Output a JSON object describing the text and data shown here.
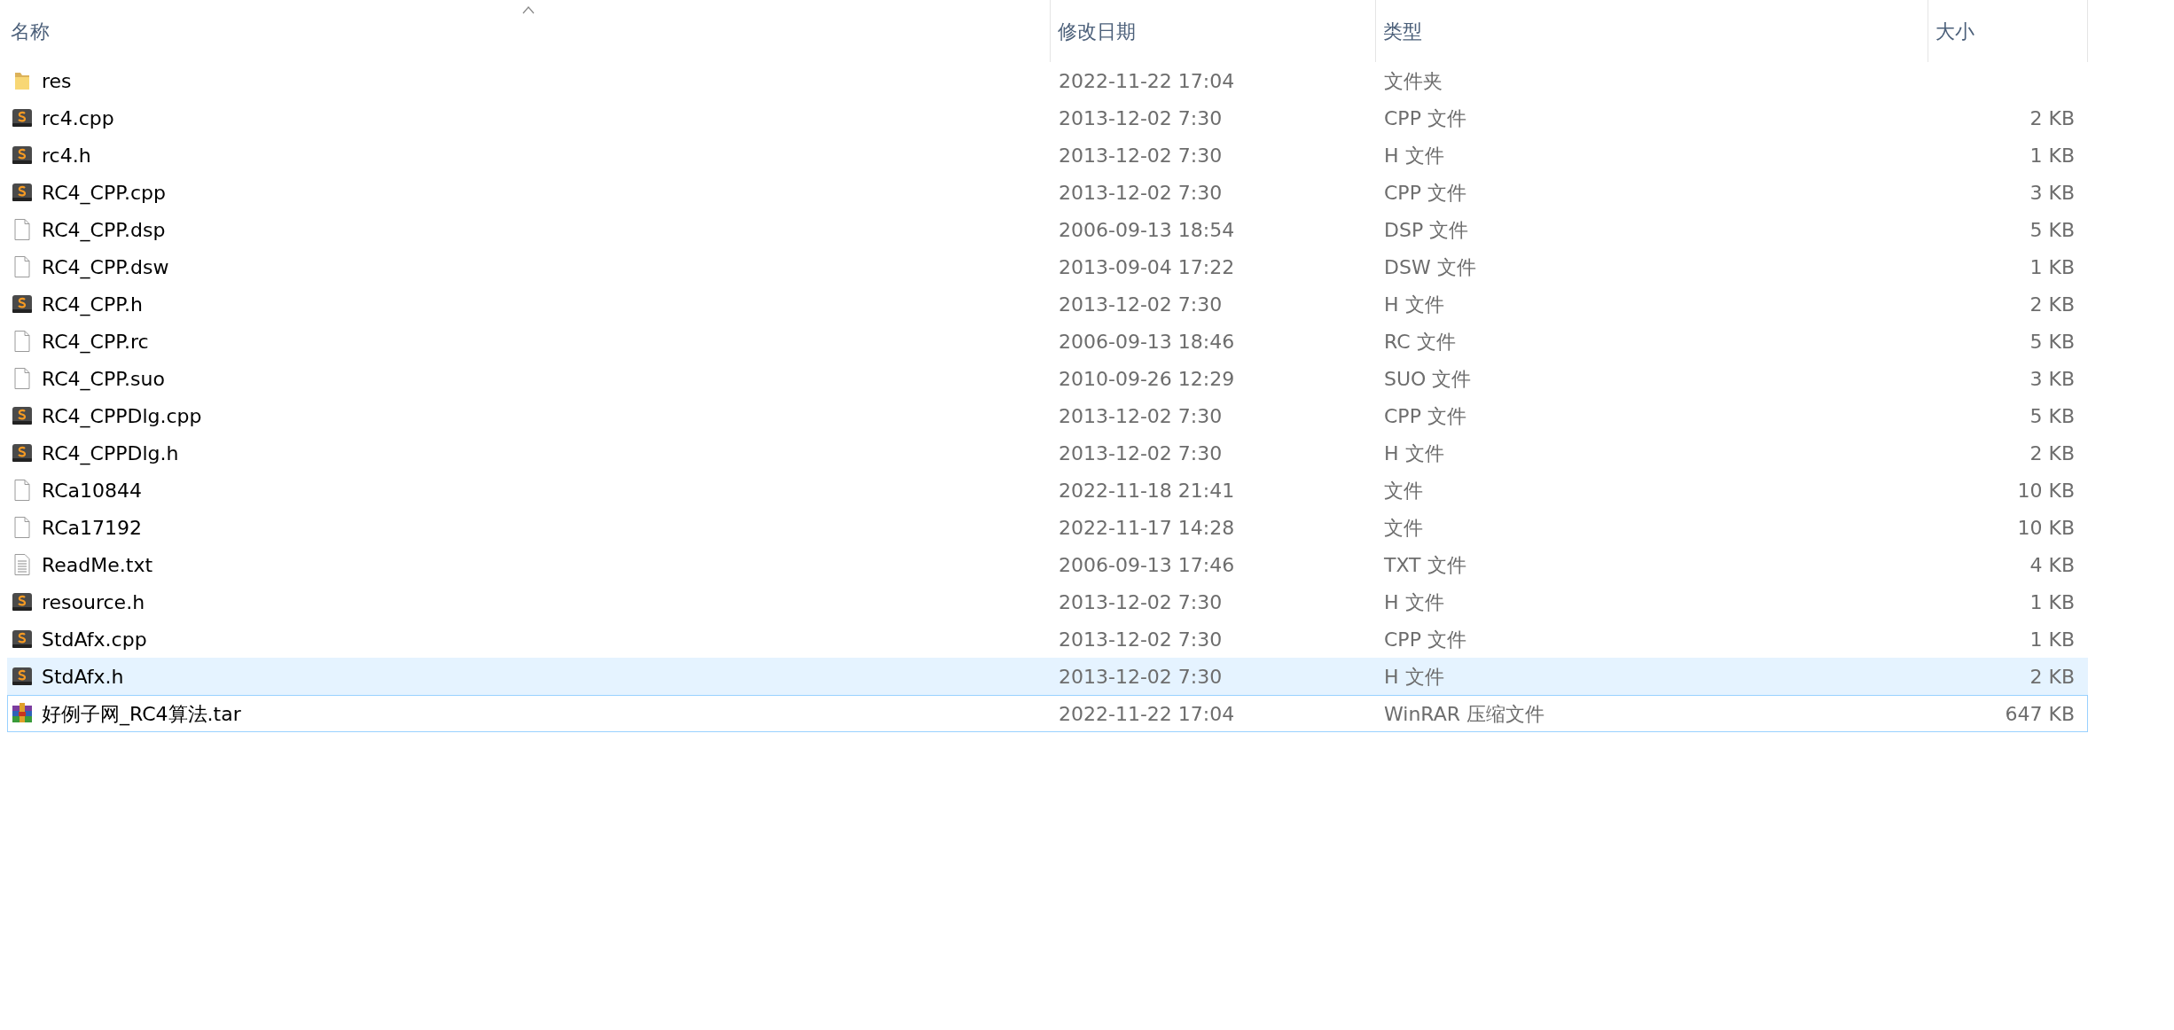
{
  "columns": [
    {
      "label": "名称",
      "sorted": true
    },
    {
      "label": "修改日期",
      "sorted": false
    },
    {
      "label": "类型",
      "sorted": false
    },
    {
      "label": "大小",
      "sorted": false
    }
  ],
  "files": [
    {
      "name": "res",
      "kind": "folder",
      "modified": "2022-11-22 17:04",
      "type": "文件夹",
      "highlighted": false,
      "focused": false
    },
    {
      "name": "rc4.cpp",
      "kind": "source",
      "modified": "2013-12-02 7:30",
      "type": "CPP 文件",
      "size": "2 KB",
      "highlighted": false,
      "focused": false
    },
    {
      "name": "rc4.h",
      "kind": "source",
      "modified": "2013-12-02 7:30",
      "type": "H 文件",
      "size": "1 KB",
      "highlighted": false,
      "focused": false
    },
    {
      "name": "RC4_CPP.cpp",
      "kind": "source",
      "modified": "2013-12-02 7:30",
      "type": "CPP 文件",
      "size": "3 KB",
      "highlighted": false,
      "focused": false
    },
    {
      "name": "RC4_CPP.dsp",
      "kind": "blank",
      "modified": "2006-09-13 18:54",
      "type": "DSP 文件",
      "size": "5 KB",
      "highlighted": false,
      "focused": false
    },
    {
      "name": "RC4_CPP.dsw",
      "kind": "blank",
      "modified": "2013-09-04 17:22",
      "type": "DSW 文件",
      "size": "1 KB",
      "highlighted": false,
      "focused": false
    },
    {
      "name": "RC4_CPP.h",
      "kind": "source",
      "modified": "2013-12-02 7:30",
      "type": "H 文件",
      "size": "2 KB",
      "highlighted": false,
      "focused": false
    },
    {
      "name": "RC4_CPP.rc",
      "kind": "blank",
      "modified": "2006-09-13 18:46",
      "type": "RC 文件",
      "size": "5 KB",
      "highlighted": false,
      "focused": false
    },
    {
      "name": "RC4_CPP.suo",
      "kind": "blank",
      "modified": "2010-09-26 12:29",
      "type": "SUO 文件",
      "size": "3 KB",
      "highlighted": false,
      "focused": false
    },
    {
      "name": "RC4_CPPDlg.cpp",
      "kind": "source",
      "modified": "2013-12-02 7:30",
      "type": "CPP 文件",
      "size": "5 KB",
      "highlighted": false,
      "focused": false
    },
    {
      "name": "RC4_CPPDlg.h",
      "kind": "source",
      "modified": "2013-12-02 7:30",
      "type": "H 文件",
      "size": "2 KB",
      "highlighted": false,
      "focused": false
    },
    {
      "name": "RCa10844",
      "kind": "blank",
      "modified": "2022-11-18 21:41",
      "type": "文件",
      "size": "10 KB",
      "highlighted": false,
      "focused": false
    },
    {
      "name": "RCa17192",
      "kind": "blank",
      "modified": "2022-11-17 14:28",
      "type": "文件",
      "size": "10 KB",
      "highlighted": false,
      "focused": false
    },
    {
      "name": "ReadMe.txt",
      "kind": "text",
      "modified": "2006-09-13 17:46",
      "type": "TXT 文件",
      "size": "4 KB",
      "highlighted": false,
      "focused": false
    },
    {
      "name": "resource.h",
      "kind": "source",
      "modified": "2013-12-02 7:30",
      "type": "H 文件",
      "size": "1 KB",
      "highlighted": false,
      "focused": false
    },
    {
      "name": "StdAfx.cpp",
      "kind": "source",
      "modified": "2013-12-02 7:30",
      "type": "CPP 文件",
      "size": "1 KB",
      "highlighted": false,
      "focused": false
    },
    {
      "name": "StdAfx.h",
      "kind": "source",
      "modified": "2013-12-02 7:30",
      "type": "H 文件",
      "size": "2 KB",
      "highlighted": true,
      "focused": false
    },
    {
      "name": "好例子网_RC4算法.tar",
      "kind": "archive",
      "modified": "2022-11-22 17:04",
      "type": "WinRAR 压缩文件",
      "size": "647 KB",
      "highlighted": false,
      "focused": true
    }
  ]
}
